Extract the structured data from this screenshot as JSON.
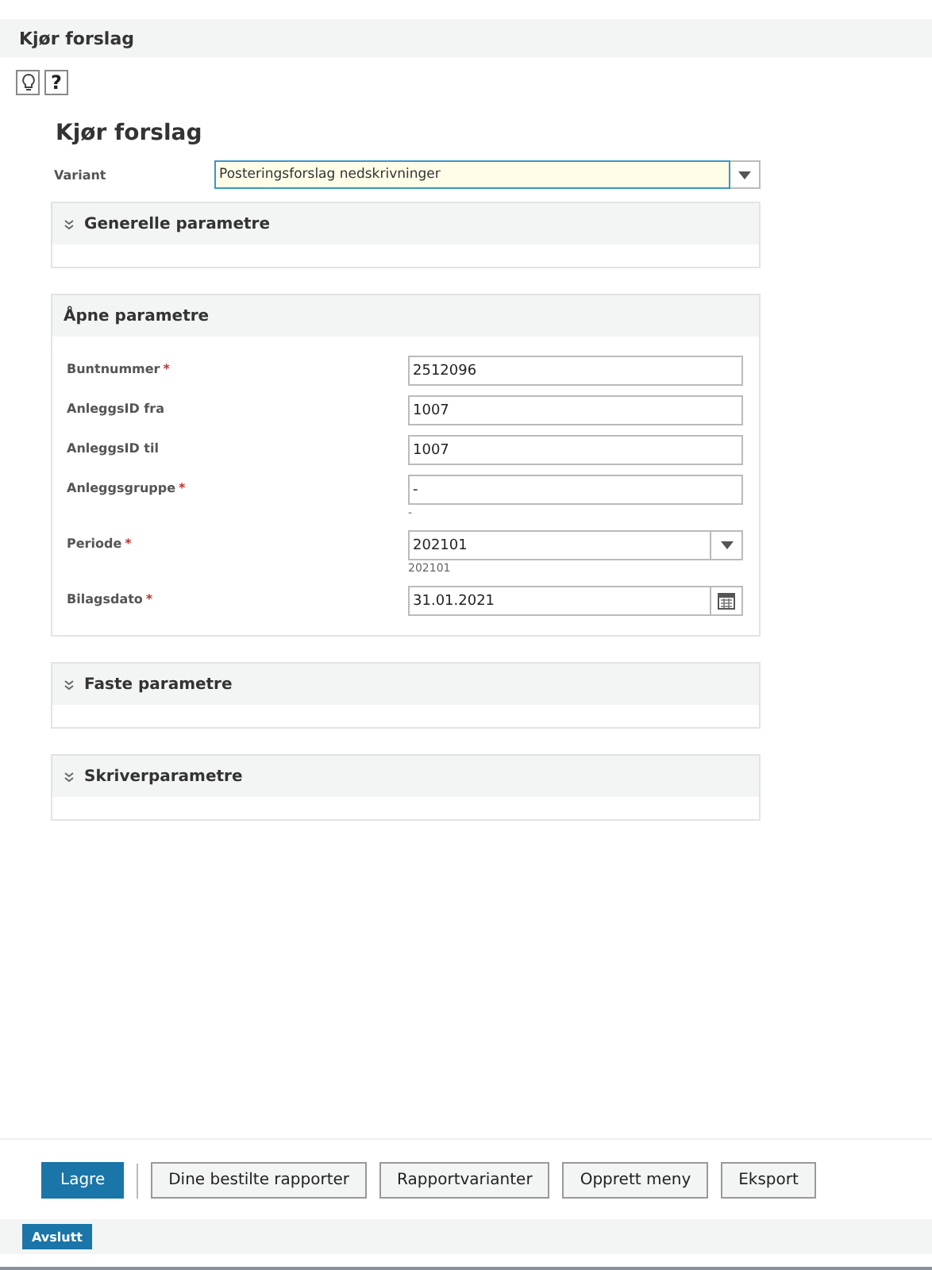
{
  "page_title": "Kjør forslag",
  "toolbar_icons": [
    {
      "kind": "bulb"
    },
    {
      "kind": "help",
      "glyph": "?"
    }
  ],
  "form_title": "Kjør forslag",
  "variant": {
    "label": "Variant",
    "value": "Posteringsforslag nedskrivninger"
  },
  "sections": [
    {
      "title": "Generelle parametre",
      "expanded": false
    },
    {
      "title": "Åpne parametre",
      "expanded": true,
      "fields": [
        {
          "label": "Buntnummer",
          "required_mark": "*",
          "kind": "text",
          "value": "2512096"
        },
        {
          "label": "AnleggsID fra",
          "kind": "text",
          "value": "1007"
        },
        {
          "label": "AnleggsID til",
          "kind": "text",
          "value": "1007"
        },
        {
          "label": "Anleggsgruppe",
          "required_mark": "*",
          "kind": "text",
          "value": "-",
          "hint": "-"
        },
        {
          "label": "Periode",
          "required_mark": "*",
          "kind": "select",
          "value": "202101",
          "hint": "202101"
        },
        {
          "label": "Bilagsdato",
          "required_mark": "*",
          "kind": "date",
          "value": "31.01.2021"
        }
      ]
    },
    {
      "title": "Faste parametre",
      "expanded": false
    },
    {
      "title": "Skriverparametre",
      "expanded": false
    }
  ],
  "buttons": [
    {
      "label": "Lagre",
      "primary": true
    },
    {
      "label": "Dine bestilte rapporter",
      "primary": false
    },
    {
      "label": "Rapportvarianter",
      "primary": false
    },
    {
      "label": "Opprett meny",
      "primary": false
    },
    {
      "label": "Eksport",
      "primary": false
    }
  ],
  "footer_button": "Avslutt"
}
